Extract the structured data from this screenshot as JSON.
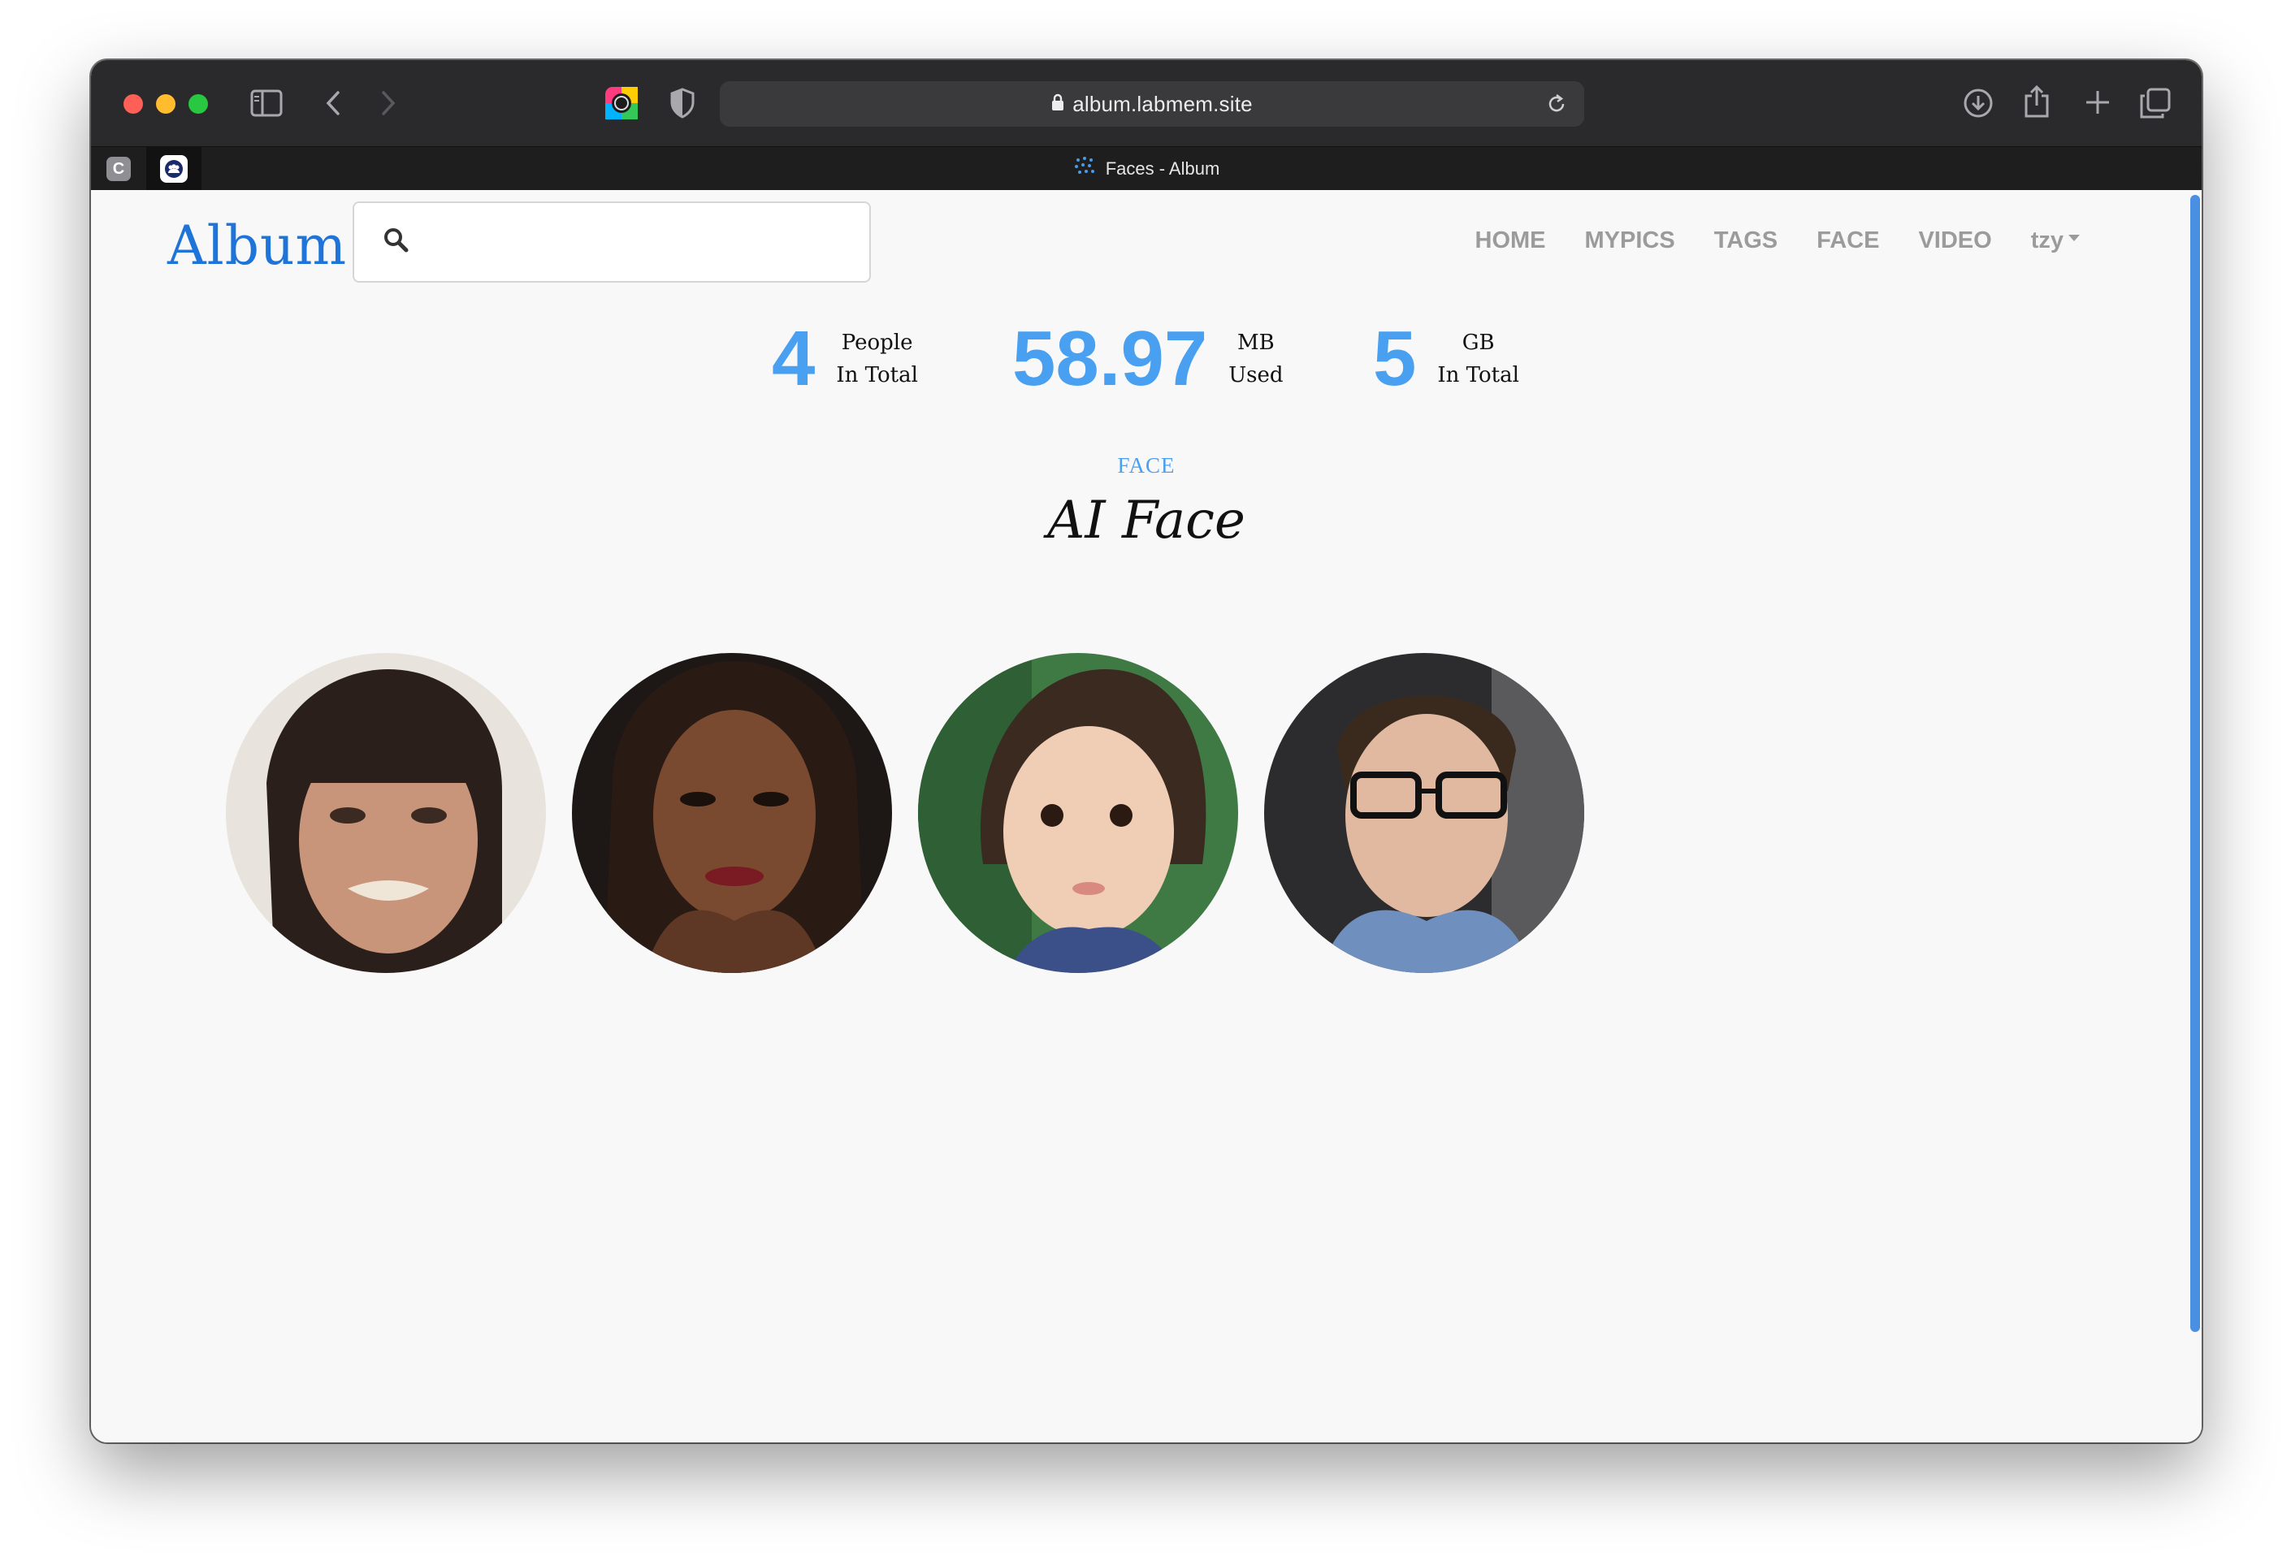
{
  "browser": {
    "url": "album.labmem.site",
    "tab_title": "Faces - Album",
    "pinned_tabs": [
      {
        "name": "C",
        "icon": "c-letter-icon"
      },
      {
        "name": "group",
        "icon": "people-icon"
      }
    ]
  },
  "header": {
    "logo": "Album",
    "search_placeholder": "",
    "nav": [
      "HOME",
      "MYPICS",
      "TAGS",
      "FACE",
      "VIDEO"
    ],
    "user": "tzy"
  },
  "stats": [
    {
      "value": "4",
      "line1": "People",
      "line2": "In Total"
    },
    {
      "value": "58.97",
      "line1": "MB",
      "line2": "Used"
    },
    {
      "value": "5",
      "line1": "GB",
      "line2": "In Total"
    }
  ],
  "section": {
    "label": "FACE",
    "title": "AI Face"
  },
  "faces": [
    {
      "name": "face-1",
      "colors": [
        "#e8e3dc",
        "#2a1f1a",
        "#c9957a"
      ]
    },
    {
      "name": "face-2",
      "colors": [
        "#1d1715",
        "#2a1a14",
        "#7a4a30"
      ]
    },
    {
      "name": "face-3",
      "colors": [
        "#3f7a45",
        "#3a2a20",
        "#f0cdb5"
      ]
    },
    {
      "name": "face-4",
      "colors": [
        "#2c2c2e",
        "#3a2a1e",
        "#e0b9a0"
      ]
    }
  ],
  "accent_color": "#4aa0f0"
}
